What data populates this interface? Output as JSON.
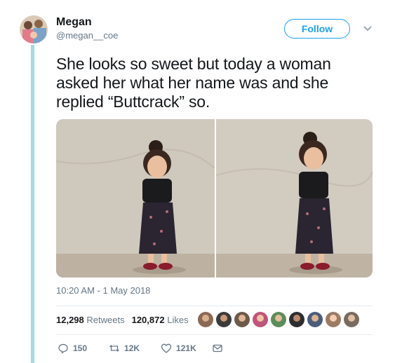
{
  "user": {
    "name": "Megan",
    "handle": "@megan__coe"
  },
  "follow_label": "Follow",
  "tweet": {
    "lines": [
      "She looks so sweet but today a woman",
      "asked her what her name was and she",
      "replied “Buttcrack” so."
    ],
    "timestamp": "10:20 AM - 1 May 2018"
  },
  "stats": {
    "retweets_count": "12,298",
    "retweets_label": "Retweets",
    "likes_count": "120,872",
    "likes_label": "Likes"
  },
  "actions": {
    "replies": "150",
    "retweets": "12K",
    "likes": "121K"
  },
  "colors": {
    "accent": "#1da1f2",
    "thread_line": "#9fdde2",
    "muted": "#657786"
  },
  "icons": [
    "chevron-down-icon",
    "reply-icon",
    "retweet-icon",
    "heart-icon",
    "message-icon"
  ]
}
